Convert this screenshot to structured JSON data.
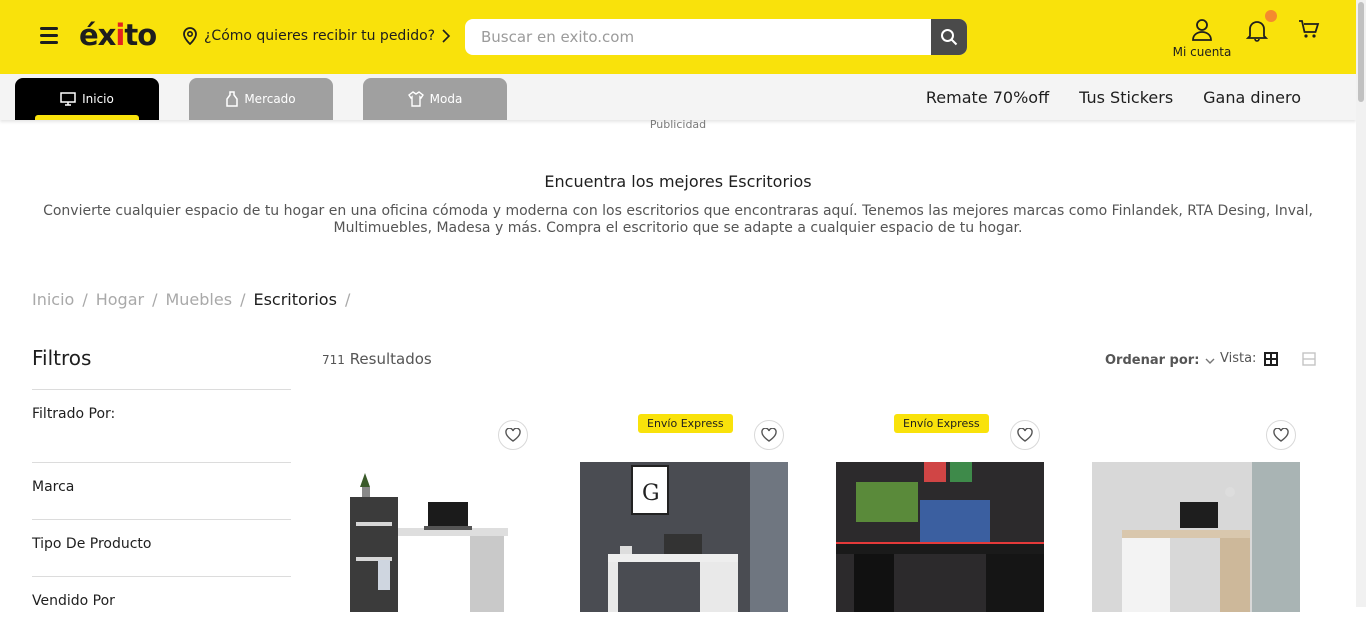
{
  "header": {
    "logo": "éxito",
    "delivery_prompt": "¿Cómo quieres recibir tu pedido?",
    "search_placeholder": "Buscar en exito.com",
    "account_label": "Mi cuenta"
  },
  "nav": {
    "tabs": [
      {
        "label": "Inicio",
        "active": true
      },
      {
        "label": "Mercado",
        "active": false
      },
      {
        "label": "Moda",
        "active": false
      }
    ],
    "links": [
      "Remate 70%off",
      "Tus Stickers",
      "Gana dinero"
    ]
  },
  "page": {
    "ad_label": "Publicidad",
    "title": "Encuentra los mejores Escritorios",
    "description": "Convierte cualquier espacio de tu hogar en una oficina cómoda y moderna con los escritorios que encontraras aquí. Tenemos las mejores marcas como Finlandek, RTA Desing, Inval, Multimuebles, Madesa y más. Compra el escritorio que se adapte a cualquier espacio de tu hogar.",
    "breadcrumbs": [
      "Inicio",
      "Hogar",
      "Muebles",
      "Escritorios"
    ]
  },
  "filters": {
    "title": "Filtros",
    "filtered_by": "Filtrado Por:",
    "sections": [
      "Marca",
      "Tipo De Producto",
      "Vendido Por"
    ]
  },
  "results": {
    "count": "711",
    "label": "Resultados",
    "order_label": "Ordenar por:",
    "view_label": "Vista:"
  },
  "products": [
    {
      "badge": ""
    },
    {
      "badge": "Envío Express"
    },
    {
      "badge": "Envío Express"
    },
    {
      "badge": ""
    }
  ],
  "colors": {
    "brand_yellow": "#f9e20b",
    "brand_red": "#e4231f",
    "notification": "#f58a2e"
  }
}
